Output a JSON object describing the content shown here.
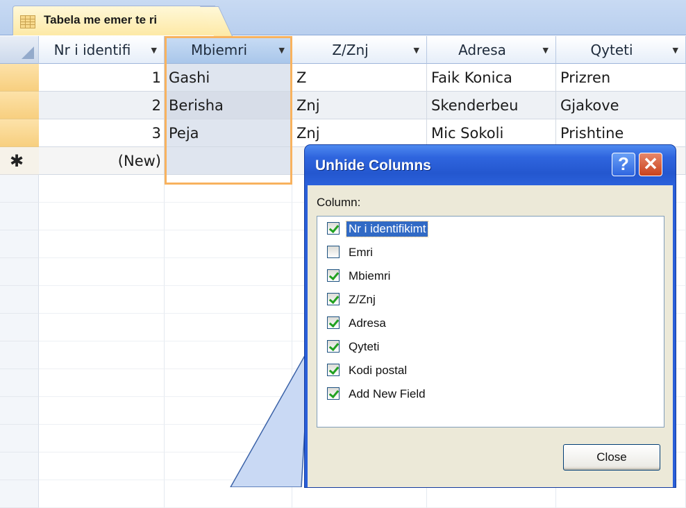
{
  "tab": {
    "label": "Tabela me emer te ri",
    "icon": "table-icon"
  },
  "columns": [
    {
      "label": "Nr i identifi",
      "icon": "dropdown-arrow-icon"
    },
    {
      "label": "Mbiemri",
      "icon": "dropdown-arrow-icon",
      "selected": true
    },
    {
      "label": "Z/Znj",
      "icon": "dropdown-arrow-icon"
    },
    {
      "label": "Adresa",
      "icon": "dropdown-arrow-icon"
    },
    {
      "label": "Qyteti",
      "icon": "dropdown-arrow-icon"
    }
  ],
  "rows": [
    [
      "1",
      "Gashi",
      "Z",
      "Faik Konica",
      "Prizren"
    ],
    [
      "2",
      "Berisha",
      "Znj",
      "Skenderbeu",
      "Gjakove"
    ],
    [
      "3",
      "Peja",
      "Znj",
      "Mic Sokoli",
      "Prishtine"
    ]
  ],
  "new_row": {
    "marker_icon": "new-record-star-icon",
    "id_text": "(New)"
  },
  "dialog": {
    "title": "Unhide Columns",
    "help_label": "?",
    "close_icon": "close-icon",
    "list_label": "Column:",
    "items": [
      {
        "label": "Nr i identifikimt",
        "checked": true,
        "focused": true
      },
      {
        "label": "Emri",
        "checked": false
      },
      {
        "label": "Mbiemri",
        "checked": true
      },
      {
        "label": "Z/Znj",
        "checked": true
      },
      {
        "label": "Adresa",
        "checked": true
      },
      {
        "label": "Qyteti",
        "checked": true
      },
      {
        "label": "Kodi postal",
        "checked": true
      },
      {
        "label": "Add New Field",
        "checked": true
      }
    ],
    "close_button": "Close"
  },
  "colors": {
    "highlight_border": "#f8b25e",
    "dialog_title_bar": "#2457cf",
    "selected_item": "#316ac5",
    "callout_fill": "#c9d9f4"
  }
}
